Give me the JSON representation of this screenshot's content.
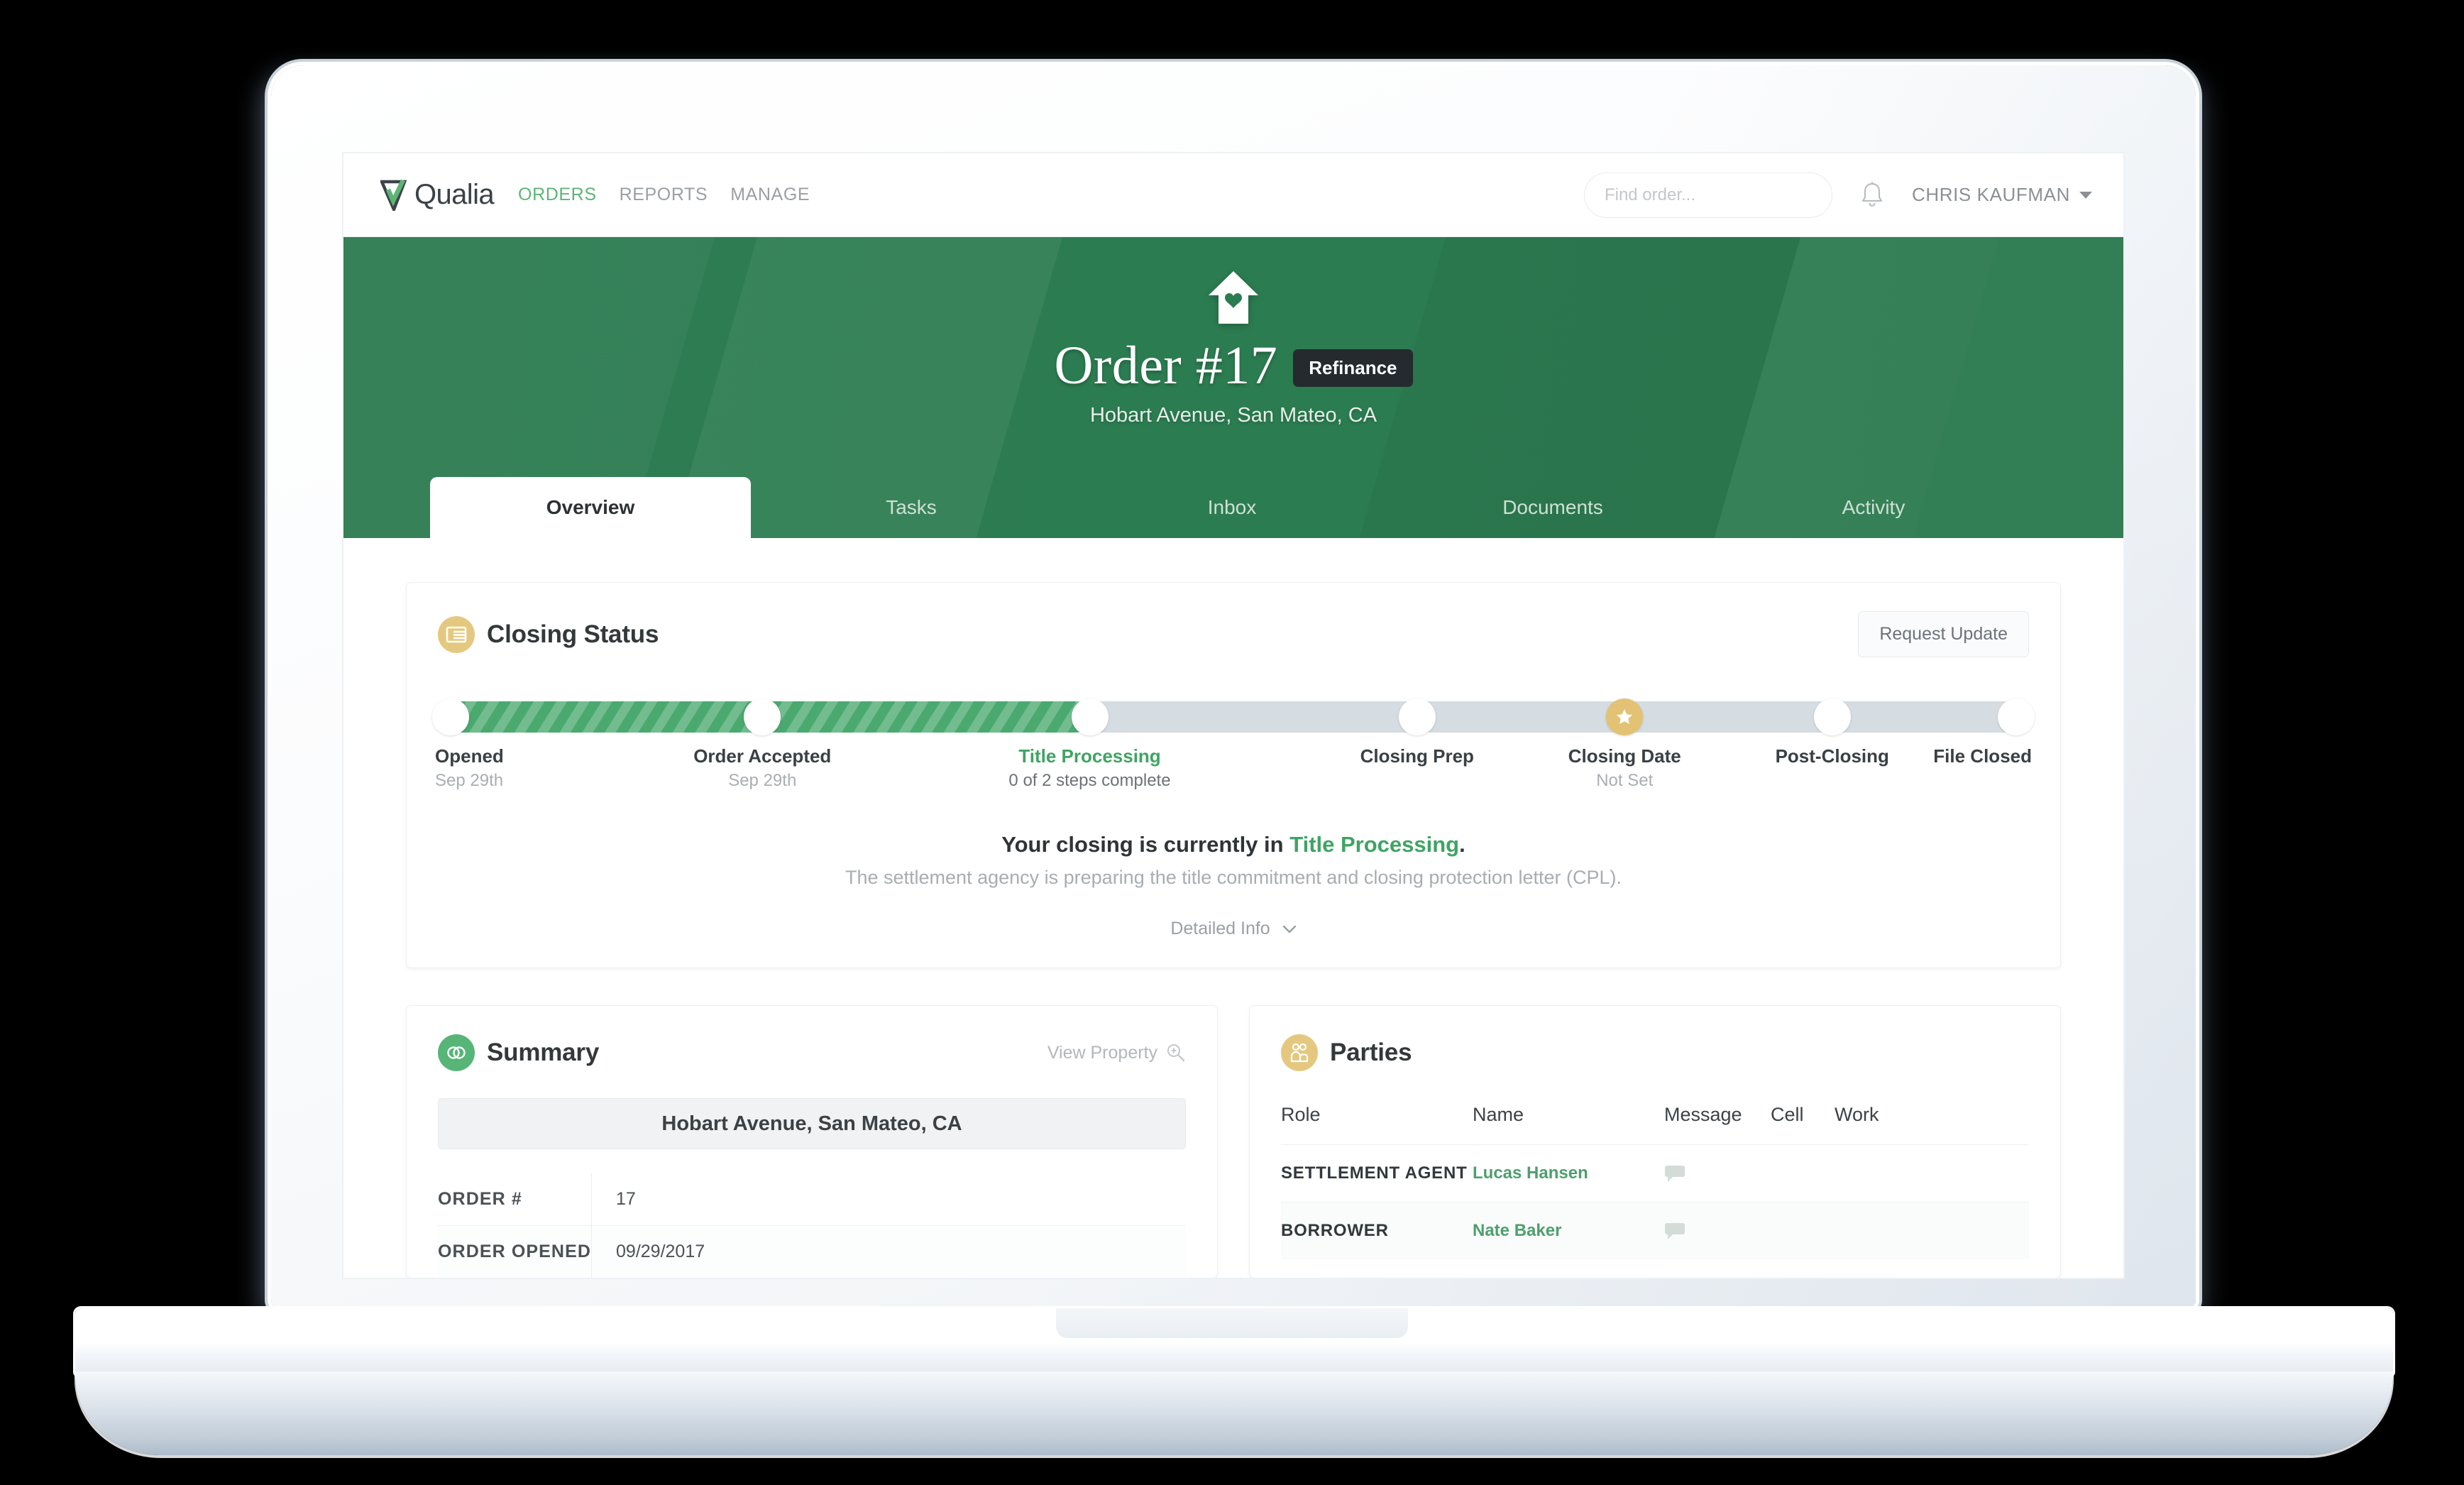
{
  "navbar": {
    "brand": "Qualia",
    "links": [
      {
        "label": "ORDERS",
        "active": true
      },
      {
        "label": "REPORTS",
        "active": false
      },
      {
        "label": "MANAGE",
        "active": false
      }
    ],
    "search_placeholder": "Find order...",
    "search_value": "",
    "user_name": "CHRIS KAUFMAN"
  },
  "hero": {
    "title": "Order #17",
    "badge": "Refinance",
    "address": "Hobart Avenue, San Mateo, CA"
  },
  "tabs": [
    {
      "label": "Overview",
      "active": true
    },
    {
      "label": "Tasks",
      "active": false
    },
    {
      "label": "Inbox",
      "active": false
    },
    {
      "label": "Documents",
      "active": false
    },
    {
      "label": "Activity",
      "active": false
    }
  ],
  "closing_status": {
    "title": "Closing Status",
    "request_update_label": "Request Update",
    "progress_percent": 41,
    "milestones": [
      {
        "label": "Opened",
        "sub": "Sep 29th",
        "pos": 0,
        "state": "done",
        "current": false
      },
      {
        "label": "Order Accepted",
        "sub": "Sep 29th",
        "pos": 20.5,
        "state": "done",
        "current": false
      },
      {
        "label": "Title Processing",
        "sub": "0 of 2 steps complete",
        "pos": 41,
        "state": "current",
        "current": true
      },
      {
        "label": "Closing Prep",
        "sub": "",
        "pos": 61.5,
        "state": "todo",
        "current": false
      },
      {
        "label": "Closing Date",
        "sub": "Not Set",
        "pos": 74.5,
        "state": "star",
        "current": false
      },
      {
        "label": "Post-Closing",
        "sub": "",
        "pos": 87.5,
        "state": "todo",
        "current": false
      },
      {
        "label": "File Closed",
        "sub": "",
        "pos": 100,
        "state": "todo",
        "current": false
      }
    ],
    "status_prefix": "Your closing is currently in ",
    "status_highlight": "Title Processing",
    "status_suffix": ".",
    "status_sub": "The settlement agency is preparing the title commitment and closing protection letter (CPL).",
    "detailed_info_label": "Detailed Info"
  },
  "summary": {
    "title": "Summary",
    "view_property_label": "View Property",
    "address": "Hobart Avenue, San Mateo, CA",
    "rows": [
      {
        "key": "ORDER #",
        "value": "17"
      },
      {
        "key": "ORDER OPENED",
        "value": "09/29/2017"
      }
    ]
  },
  "parties": {
    "title": "Parties",
    "columns": [
      "Role",
      "Name",
      "Message",
      "Cell",
      "Work"
    ],
    "rows": [
      {
        "role": "SETTLEMENT AGENT",
        "name": "Lucas Hansen",
        "message": "bubble",
        "cell": "",
        "work": ""
      },
      {
        "role": "BORROWER",
        "name": "Nate Baker",
        "message": "bubble",
        "cell": "",
        "work": ""
      }
    ]
  },
  "colors": {
    "brand_green": "#5cb577",
    "hero_green": "#2c7c51",
    "progress_green": "#4aa96f",
    "accent_tan": "#e3c274",
    "badge_dark": "#242a2d",
    "link_green": "#4e9f6e"
  }
}
